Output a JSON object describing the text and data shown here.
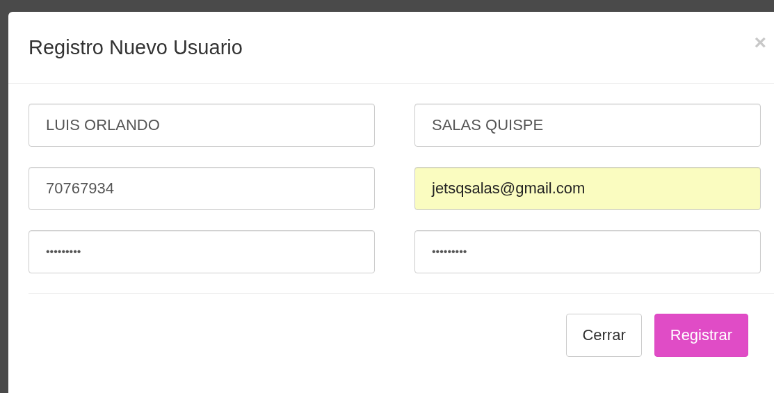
{
  "modal": {
    "title": "Registro Nuevo Usuario",
    "close": "×"
  },
  "fields": [
    {
      "kind": "text",
      "value": "LUIS ORLANDO",
      "autofilled": false
    },
    {
      "kind": "text",
      "value": "SALAS QUISPE",
      "autofilled": false
    },
    {
      "kind": "text",
      "value": "70767934",
      "autofilled": false
    },
    {
      "kind": "text",
      "value": "jetsqsalas@gmail.com",
      "autofilled": true
    },
    {
      "kind": "password",
      "value": "•••••••••",
      "autofilled": false
    },
    {
      "kind": "password",
      "value": "•••••••••",
      "autofilled": false
    }
  ],
  "buttons": [
    {
      "kind": "default",
      "label": "Cerrar"
    },
    {
      "kind": "primary",
      "label": "Registrar"
    }
  ]
}
